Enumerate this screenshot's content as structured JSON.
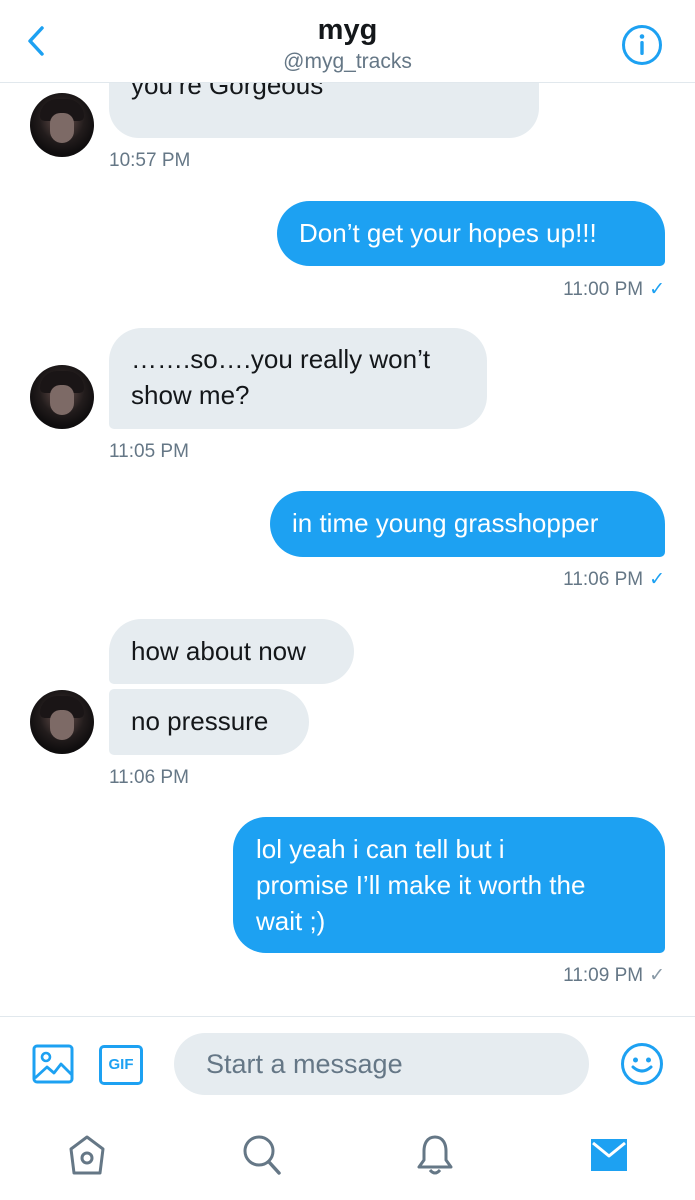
{
  "header": {
    "name": "myg",
    "handle": "@myg_tracks",
    "back_icon": "chevron-left-icon",
    "info_icon": "info-icon"
  },
  "messages": [
    {
      "text": "you’re Gorgeous",
      "time": "10:57 PM"
    },
    {
      "text": "Don’t get your hopes up!!!",
      "time": "11:00 PM",
      "status": "read"
    },
    {
      "text_lines": [
        "…….so….you really won’t",
        "show me?"
      ],
      "time": "11:05 PM"
    },
    {
      "text": "in time young grasshopper",
      "time": "11:06 PM",
      "status": "read"
    },
    {
      "text": "how about now"
    },
    {
      "text": "no pressure",
      "time": "11:06 PM"
    },
    {
      "text_lines": [
        "lol yeah i can tell but i",
        "promise I’ll make it worth the",
        "wait ;)"
      ],
      "time": "11:09 PM",
      "status": "sent"
    }
  ],
  "composer": {
    "placeholder": "Start a message",
    "image_icon": "image-icon",
    "gif_label": "GIF",
    "emoji_icon": "emoji-icon"
  },
  "tabbar": [
    {
      "icon": "home-icon",
      "active": false
    },
    {
      "icon": "search-icon",
      "active": false
    },
    {
      "icon": "notifications-icon",
      "active": false
    },
    {
      "icon": "messages-icon",
      "active": true
    }
  ],
  "colors": {
    "accent": "#1da1f2",
    "incoming_bubble": "#e6ecf0",
    "secondary_text": "#657786",
    "inactive_icon": "#657786"
  }
}
